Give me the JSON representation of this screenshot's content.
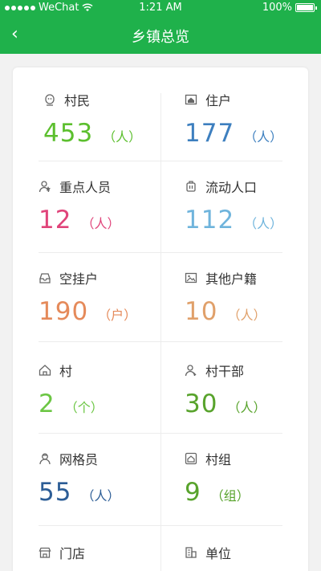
{
  "status": {
    "carrier": "WeChat",
    "time": "1:21 AM",
    "battery": "100%"
  },
  "nav": {
    "title": "乡镇总览",
    "back_icon": "‹"
  },
  "cells": [
    {
      "label": "村民",
      "value": "453",
      "unit": "（人）",
      "color": "#5cbf2e",
      "icon": "resident-icon"
    },
    {
      "label": "住户",
      "value": "177",
      "unit": "（人）",
      "color": "#3d7fbf",
      "icon": "home-icon"
    },
    {
      "label": "重点人员",
      "value": "12",
      "unit": "（人）",
      "color": "#e0447a",
      "icon": "key-person-icon"
    },
    {
      "label": "流动人口",
      "value": "112",
      "unit": "（人）",
      "color": "#6fb4dc",
      "icon": "luggage-icon"
    },
    {
      "label": "空挂户",
      "value": "190",
      "unit": "（户）",
      "color": "#e58a5a",
      "icon": "inbox-icon"
    },
    {
      "label": "其他户籍",
      "value": "10",
      "unit": "（人）",
      "color": "#e0a06a",
      "icon": "picture-icon"
    },
    {
      "label": "村",
      "value": "2",
      "unit": "（个）",
      "color": "#6cc644",
      "icon": "village-icon"
    },
    {
      "label": "村干部",
      "value": "30",
      "unit": "（人）",
      "color": "#58a32c",
      "icon": "cadre-icon"
    },
    {
      "label": "网格员",
      "value": "55",
      "unit": "（人）",
      "color": "#2c5d96",
      "icon": "grid-member-icon"
    },
    {
      "label": "村组",
      "value": "9",
      "unit": "（组）",
      "color": "#58a32c",
      "icon": "group-icon"
    },
    {
      "label": "门店",
      "value": "",
      "unit": "",
      "color": "#333333",
      "icon": "store-icon"
    },
    {
      "label": "单位",
      "value": "",
      "unit": "",
      "color": "#333333",
      "icon": "building-icon"
    }
  ]
}
